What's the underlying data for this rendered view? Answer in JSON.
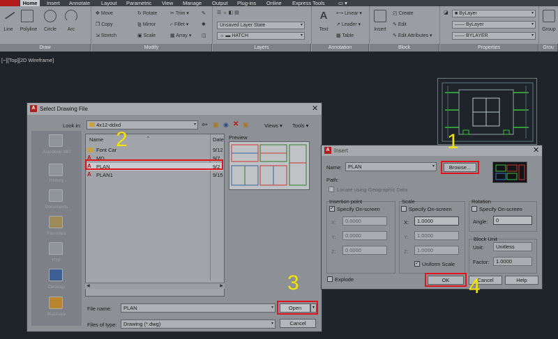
{
  "ribbon": {
    "tabs": [
      "Home",
      "Insert",
      "Annotate",
      "Layout",
      "Parametric",
      "View",
      "Manage",
      "Output",
      "Plug-ins",
      "Online",
      "Express Tools"
    ],
    "active_tab": "Home",
    "draw": {
      "line": "Line",
      "polyline": "Polyline",
      "circle": "Circle",
      "arc": "Arc",
      "label": "Draw"
    },
    "modify": {
      "move": "Move",
      "copy": "Copy",
      "stretch": "Stretch",
      "rotate": "Rotate",
      "mirror": "Mirror",
      "scale": "Scale",
      "trim": "Trim",
      "fillet": "Fillet",
      "array": "Array",
      "label": "Modify"
    },
    "layers": {
      "state": "Unsaved Layer State",
      "hatch": "HATCH",
      "label": "Layers"
    },
    "annotation": {
      "text": "Text",
      "linear": "Linear",
      "leader": "Leader",
      "table": "Table",
      "label": "Annotation"
    },
    "block": {
      "insert": "Insert",
      "create": "Create",
      "edit": "Edit",
      "edit_attributes": "Edit Attributes",
      "label": "Block"
    },
    "properties": {
      "bylayer1": "ByLayer",
      "bylayer2": "ByLayer",
      "bylayer3": "BYLAYER",
      "label": "Properties"
    },
    "groups": {
      "group": "Group",
      "label": "Grou"
    }
  },
  "viewport": {
    "label": "[−][Top][2D Wireframe]"
  },
  "select_file": {
    "title": "Select Drawing File",
    "look_in_label": "Look in:",
    "look_in_value": "4x12-ddxd",
    "views": "Views",
    "tools": "Tools",
    "places": [
      "Autodesk 360",
      "History",
      "Documents",
      "Favorites",
      "FTP",
      "Desktop",
      "Buzzsaw"
    ],
    "columns": {
      "name": "Name",
      "date": "Date"
    },
    "files": [
      {
        "name": "Font Car",
        "date": "9/12",
        "kind": "folder"
      },
      {
        "name": "MD",
        "date": "9/7",
        "kind": "dwg"
      },
      {
        "name": "PLAN",
        "date": "9/2",
        "kind": "dwg"
      },
      {
        "name": "PLAN1",
        "date": "9/15",
        "kind": "dwg"
      }
    ],
    "preview_label": "Preview",
    "file_name_label": "File name:",
    "file_name_value": "PLAN",
    "file_type_label": "Files of type:",
    "file_type_value": "Drawing (*.dwg)",
    "open": "Open",
    "cancel": "Cancel"
  },
  "insert": {
    "title": "Insert",
    "name_label": "Name:",
    "name_value": "PLAN",
    "browse": "Browse...",
    "path_label": "Path:",
    "locate_geo": "Locate using Geographic Data",
    "insertion_point": {
      "title": "Insertion point",
      "specify": "Specify On-screen",
      "x": "0.0000",
      "y": "0.0000",
      "z": "0.0000"
    },
    "scale": {
      "title": "Scale",
      "specify": "Specify On-screen",
      "x": "1.0000",
      "y": "1.0000",
      "z": "1.0000",
      "uniform": "Uniform Scale"
    },
    "rotation": {
      "title": "Rotation",
      "specify": "Specify On-screen",
      "angle_label": "Angle:",
      "angle": "0"
    },
    "block_unit": {
      "title": "Block Unit",
      "unit_label": "Unit:",
      "unit": "Unitless",
      "factor_label": "Factor:",
      "factor": "1.0000"
    },
    "explode": "Explode",
    "ok": "OK",
    "cancel": "Cancel",
    "help": "Help",
    "axis_x": "X:",
    "axis_y": "Y:",
    "axis_z": "Z:"
  },
  "steps": {
    "one": "1",
    "two": "2",
    "three": "3",
    "four": "4"
  },
  "colors": {
    "highlight": "#e0151b",
    "step_number": "#f1e10c"
  }
}
